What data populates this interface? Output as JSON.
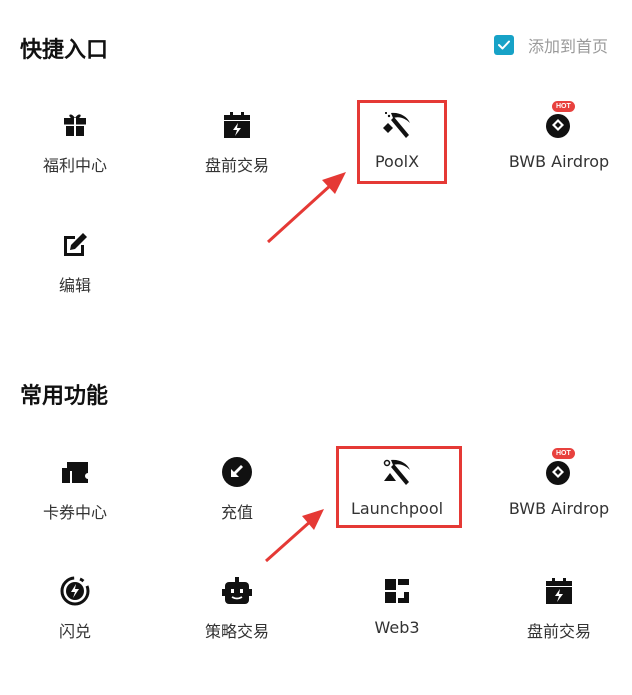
{
  "quick_access": {
    "title": "快捷入口",
    "add_to_home_label": "添加到首页",
    "add_to_home_checked": true,
    "items": [
      {
        "label": "福利中心",
        "icon": "gift-icon"
      },
      {
        "label": "盘前交易",
        "icon": "pre-market-icon"
      },
      {
        "label": "PoolX",
        "icon": "pickaxe-icon"
      },
      {
        "label": "BWB Airdrop",
        "icon": "airdrop-icon",
        "badge": "HOT"
      },
      {
        "label": "编辑",
        "icon": "edit-icon"
      }
    ]
  },
  "common_functions": {
    "title": "常用功能",
    "items": [
      {
        "label": "卡券中心",
        "icon": "coupon-icon"
      },
      {
        "label": "充值",
        "icon": "deposit-icon"
      },
      {
        "label": "Launchpool",
        "icon": "pickaxe-icon"
      },
      {
        "label": "BWB Airdrop",
        "icon": "airdrop-icon",
        "badge": "HOT"
      },
      {
        "label": "闪兑",
        "icon": "flash-swap-icon"
      },
      {
        "label": "策略交易",
        "icon": "bot-icon"
      },
      {
        "label": "Web3",
        "icon": "web3-icon"
      },
      {
        "label": "盘前交易",
        "icon": "pre-market-icon"
      }
    ]
  },
  "annotation_color": "#e53935",
  "accent_color": "#17a2c7"
}
